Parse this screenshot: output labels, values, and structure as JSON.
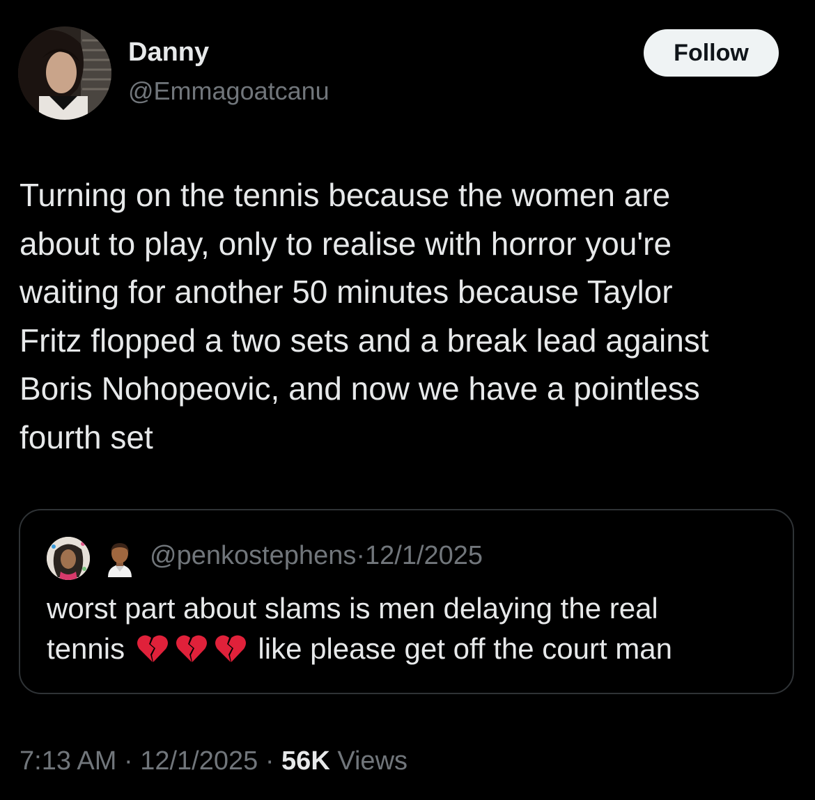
{
  "author": {
    "name": "Danny",
    "handle": "@Emmagoatcanu"
  },
  "follow_label": "Follow",
  "tweet_lines": [
    "Turning on the tennis because the women are",
    "about to play, only to realise with horror you're",
    "waiting for another 50 minutes because Taylor",
    "Fritz flopped a two sets and a break lead against",
    "Boris Nohopeovic, and now we have a pointless",
    "fourth set"
  ],
  "quote": {
    "handle": "@penkostephens",
    "separator": "·",
    "date": "12/1/2025",
    "line1": "worst part about slams is men delaying the real",
    "line2_start": "tennis",
    "line2_end": "like please get off the court man",
    "emoji": [
      "broken-heart",
      "broken-heart",
      "broken-heart"
    ]
  },
  "meta": {
    "time": "7:13 AM",
    "sep1": "·",
    "date": "12/1/2025",
    "sep2": "·",
    "views_count": "56K",
    "views_label": "Views"
  },
  "colors": {
    "background": "#000000",
    "text_primary": "#e7e9ea",
    "text_secondary": "#71767b",
    "border": "#2f3336",
    "follow_bg": "#eff3f4",
    "follow_text": "#0f1419",
    "broken_heart": "#e0213a"
  }
}
